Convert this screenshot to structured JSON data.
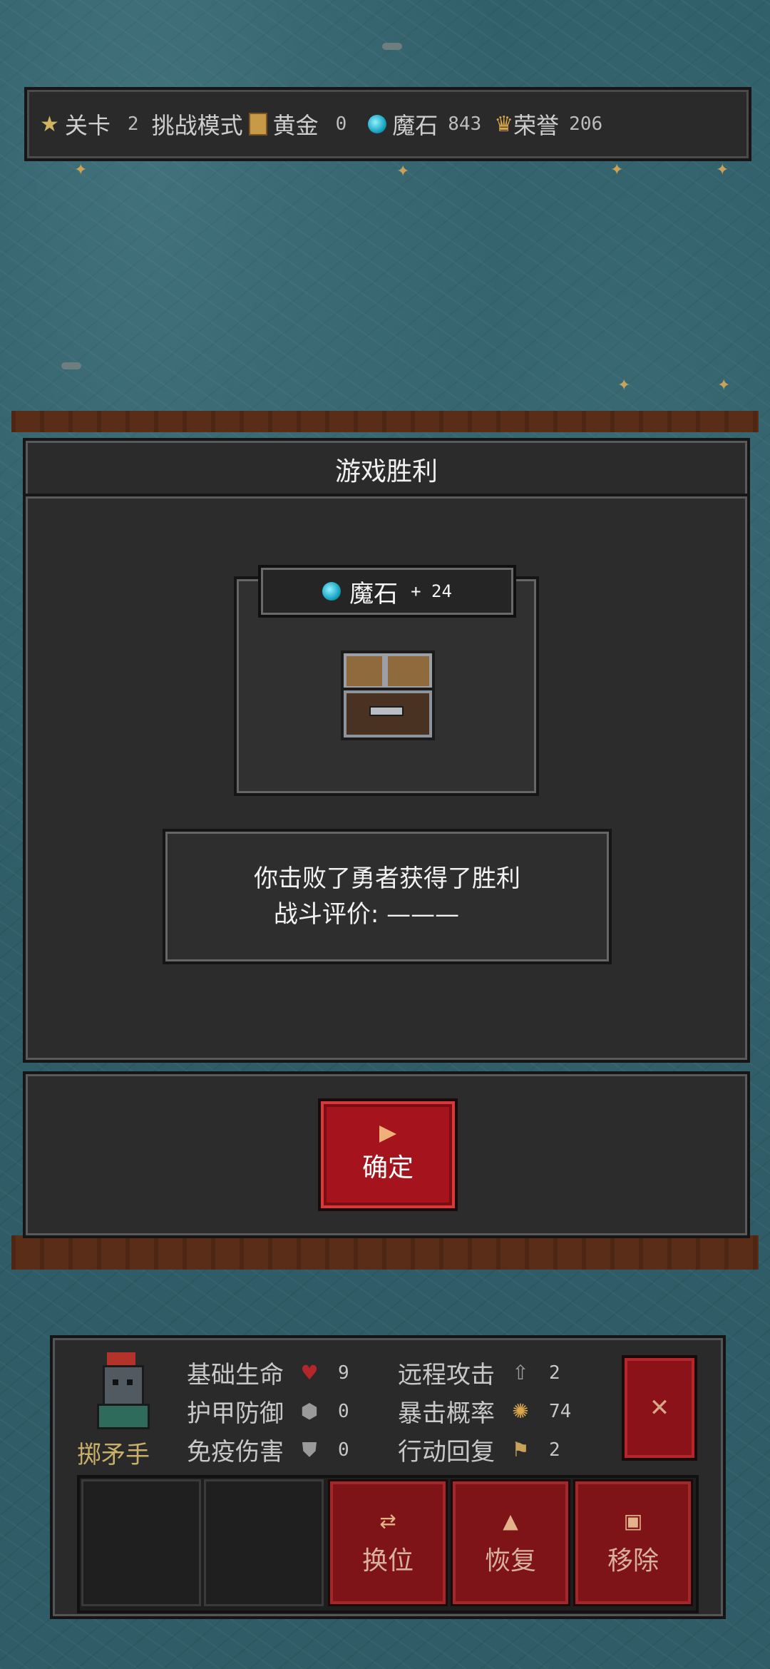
{
  "top_bar": {
    "level_label": "关卡",
    "level_value": "2",
    "mode_label": "挑战模式",
    "gold_label": "黄金",
    "gold_value": "0",
    "magic_label": "魔石",
    "magic_value": "843",
    "honor_label": "荣誉",
    "honor_value": "206"
  },
  "dialog": {
    "title": "游戏胜利",
    "reward_label": "魔石",
    "reward_amount": "+ 24",
    "message": "你击败了勇者获得了胜利",
    "rating": "战斗评价: ———",
    "confirm_label": "确定"
  },
  "unit": {
    "name": "掷矛手",
    "stats": [
      {
        "label": "基础生命",
        "value": "9",
        "icon": "heart-icon",
        "color": "#b3262c"
      },
      {
        "label": "护甲防御",
        "value": "0",
        "icon": "armor-icon",
        "color": "#9a9a9a"
      },
      {
        "label": "免疫伤害",
        "value": "0",
        "icon": "shield-icon",
        "color": "#9a9a9a"
      },
      {
        "label": "远程攻击",
        "value": "2",
        "icon": "arrow-icon",
        "color": "#9a9a9a"
      },
      {
        "label": "暴击概率",
        "value": "74",
        "icon": "burst-icon",
        "color": "#d9a64a"
      },
      {
        "label": "行动回复",
        "value": "2",
        "icon": "boot-icon",
        "color": "#c9a25a"
      }
    ],
    "actions": [
      "换位",
      "恢复",
      "移除"
    ]
  },
  "colors": {
    "accent_red": "#a5141c",
    "panel_dark": "#2c2c2c",
    "water": "#2f5c66",
    "gold_text": "#c9b06a"
  }
}
